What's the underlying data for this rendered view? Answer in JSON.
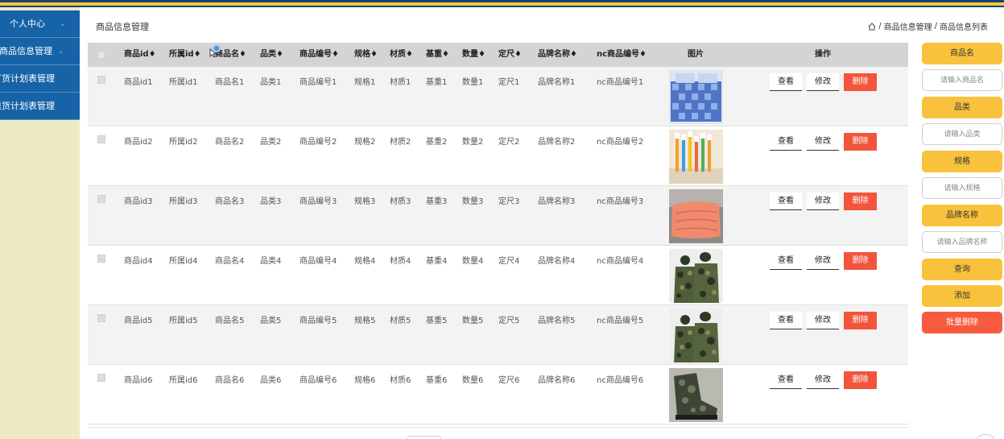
{
  "sidebar": {
    "items": [
      {
        "label": "个人中心",
        "chevron": true
      },
      {
        "label": "商品信息管理",
        "chevron": true
      },
      {
        "label": "订货计划表管理",
        "chevron": false
      },
      {
        "label": "退货计划表管理",
        "chevron": false
      }
    ]
  },
  "header": {
    "title": "商品信息管理",
    "breadcrumb": {
      "level1": "商品信息管理",
      "sep": "/",
      "level2": "商品信息列表"
    }
  },
  "table": {
    "columns": [
      "商品id",
      "所属id",
      "商品名",
      "品类",
      "商品编号",
      "规格",
      "材质",
      "基重",
      "数量",
      "定尺",
      "品牌名称",
      "nc商品编号",
      "图片",
      "操作"
    ],
    "sort_glyph": "♦",
    "rows": [
      {
        "id": "商品id1",
        "owner": "所属id1",
        "name": "商品名1",
        "cat": "品类1",
        "code": "商品编号1",
        "spec": "规格1",
        "mat": "材质1",
        "weight": "基重1",
        "qty": "数量1",
        "size": "定尺1",
        "brand": "品牌名称1",
        "nc": "nc商品编号1",
        "img": "bedding"
      },
      {
        "id": "商品id2",
        "owner": "所属id2",
        "name": "商品名2",
        "cat": "品类2",
        "code": "商品编号2",
        "spec": "规格2",
        "mat": "材质2",
        "weight": "基重2",
        "qty": "数量2",
        "size": "定尺2",
        "brand": "品牌名称2",
        "nc": "nc商品编号2",
        "img": "toothbrush"
      },
      {
        "id": "商品id3",
        "owner": "所属id3",
        "name": "商品名3",
        "cat": "品类3",
        "code": "商品编号3",
        "spec": "规格3",
        "mat": "材质3",
        "weight": "基重3",
        "qty": "数量3",
        "size": "定尺3",
        "brand": "品牌名称3",
        "nc": "nc商品编号3",
        "img": "quilt"
      },
      {
        "id": "商品id4",
        "owner": "所属id4",
        "name": "商品名4",
        "cat": "品类4",
        "code": "商品编号4",
        "spec": "规格4",
        "mat": "材质4",
        "weight": "基重4",
        "qty": "数量4",
        "size": "定尺4",
        "brand": "品牌名称4",
        "nc": "nc商品编号4",
        "img": "camo"
      },
      {
        "id": "商品id5",
        "owner": "所属id5",
        "name": "商品名5",
        "cat": "品类5",
        "code": "商品编号5",
        "spec": "规格5",
        "mat": "材质5",
        "weight": "基重5",
        "qty": "数量5",
        "size": "定尺5",
        "brand": "品牌名称5",
        "nc": "nc商品编号5",
        "img": "camo"
      },
      {
        "id": "商品id6",
        "owner": "所属id6",
        "name": "商品名6",
        "cat": "品类6",
        "code": "商品编号6",
        "spec": "规格6",
        "mat": "材质6",
        "weight": "基重6",
        "qty": "数量6",
        "size": "定尺6",
        "brand": "品牌名称6",
        "nc": "nc商品编号6",
        "img": "boots"
      }
    ],
    "actions": {
      "view": "查看",
      "edit": "修改",
      "delete": "删除"
    }
  },
  "panel": {
    "name_label": "商品名",
    "name_placeholder": "请输入商品名",
    "cat_label": "品类",
    "cat_placeholder": "请输入品类",
    "spec_label": "规格",
    "spec_placeholder": "请输入规格",
    "brand_label": "品牌名称",
    "brand_placeholder": "请输入品牌名称",
    "search": "查询",
    "add": "添加",
    "batch_delete": "批量删除"
  },
  "colors": {
    "sidebar_item": "#1663a8",
    "sidebar_bg": "#ecebc4",
    "accent_gold": "#f9c23c",
    "delete_red": "#f2553c",
    "top_navy": "#1d3f73"
  }
}
